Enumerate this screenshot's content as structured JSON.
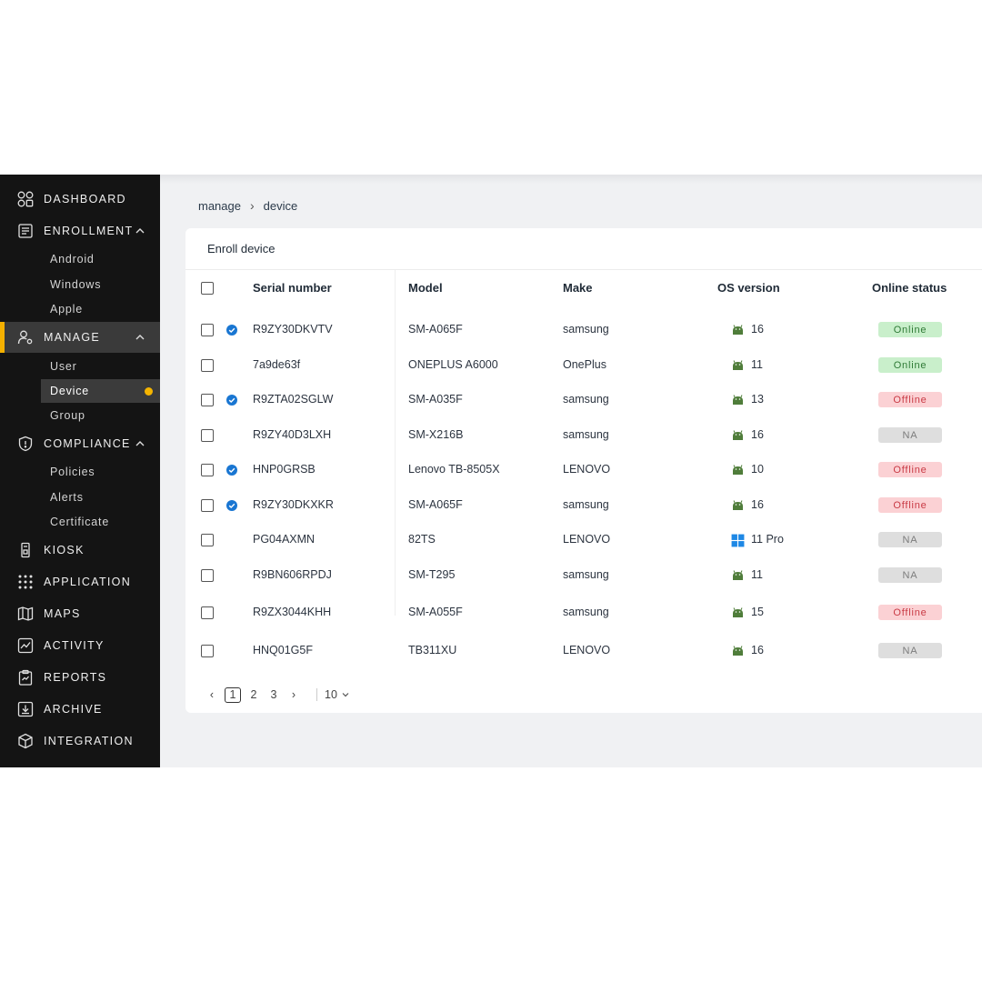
{
  "sidebar": {
    "dashboard": "DASHBOARD",
    "enrollment": "ENROLLMENT",
    "enrollment_items": [
      "Android",
      "Windows",
      "Apple"
    ],
    "manage": "MANAGE",
    "manage_items": [
      "User",
      "Device",
      "Group"
    ],
    "compliance": "COMPLIANCE",
    "compliance_items": [
      "Policies",
      "Alerts",
      "Certificate"
    ],
    "kiosk": "KIOSK",
    "application": "APPLICATION",
    "maps": "MAPS",
    "activity": "ACTIVITY",
    "reports": "REPORTS",
    "archive": "ARCHIVE",
    "integration": "INTEGRATION",
    "active_accent": "#f4b000"
  },
  "breadcrumb": {
    "parent": "manage",
    "current": "device"
  },
  "card": {
    "title": "Enroll device"
  },
  "table": {
    "columns": [
      "Serial number",
      "Model",
      "Make",
      "OS version",
      "Online status"
    ],
    "rows": [
      {
        "serial": "R9ZY30DKVTV",
        "model": "SM-A065F",
        "make": "samsung",
        "os": "16",
        "status": "Online"
      },
      {
        "serial": "7a9de63f",
        "model": "ONEPLUS A6000",
        "make": "OnePlus",
        "os": "11",
        "status": "Online"
      },
      {
        "serial": "R9ZTA02SGLW",
        "model": "SM-A035F",
        "make": "samsung",
        "os": "13",
        "status": "Offline"
      },
      {
        "serial": "R9ZY40D3LXH",
        "model": "SM-X216B",
        "make": "samsung",
        "os": "16",
        "status": "NA"
      },
      {
        "serial": "HNP0GRSB",
        "model": "Lenovo TB-8505X",
        "make": "LENOVO",
        "os": "10",
        "status": "Offline"
      },
      {
        "serial": "R9ZY30DKXKR",
        "model": "SM-A065F",
        "make": "samsung",
        "os": "16",
        "status": "Offline"
      },
      {
        "serial": "PG04AXMN",
        "model": "82TS",
        "make": "LENOVO",
        "os": "11 Pro",
        "status": "NA"
      },
      {
        "serial": "R9BN606RPDJ",
        "model": "SM-T295",
        "make": "samsung",
        "os": "11",
        "status": "NA"
      },
      {
        "serial": "R9ZX3044KHH",
        "model": "SM-A055F",
        "make": "samsung",
        "os": "15",
        "status": "Offline"
      },
      {
        "serial": "HNQ01G5F",
        "model": "TB311XU",
        "make": "LENOVO",
        "os": "16",
        "status": "NA"
      }
    ]
  },
  "pagination": {
    "pages": [
      "1",
      "2",
      "3"
    ],
    "page_size": "10"
  },
  "status_colors": {
    "online": "#2f7a36",
    "offline": "#c93a45",
    "na": "#7c7c7c"
  }
}
